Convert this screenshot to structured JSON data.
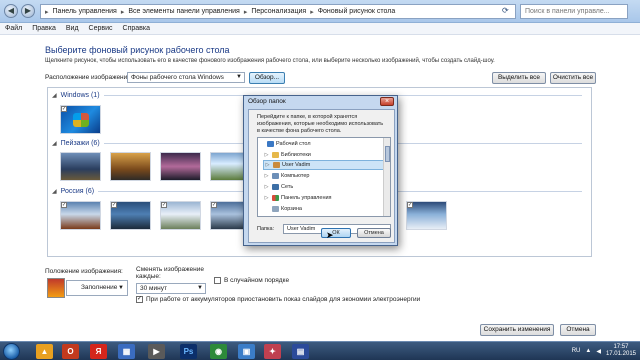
{
  "address_bar": {
    "crumbs": [
      "Панель управления",
      "Все элементы панели управления",
      "Персонализация",
      "Фоновый рисунок стола"
    ],
    "search_placeholder": "Поиск в панели управле..."
  },
  "menu": [
    "Файл",
    "Правка",
    "Вид",
    "Сервис",
    "Справка"
  ],
  "heading": "Выберите фоновый рисунок рабочего стола",
  "subtext": "Щелкните рисунок, чтобы использовать его в качестве фонового изображения рабочего стола, или выберите несколько изображений, чтобы создать слайд-шоу.",
  "location": {
    "label": "Расположение изображения:",
    "value": "Фоны рабочего стола Windows",
    "browse_label": "Обзор...",
    "select_all_label": "Выделить все",
    "clear_all_label": "Очистить все"
  },
  "groups": [
    {
      "title": "Windows (1)"
    },
    {
      "title": "Пейзажи (6)"
    },
    {
      "title": "Россия (6)"
    }
  ],
  "position": {
    "label": "Положение изображения:",
    "value": "Заполнение"
  },
  "slideshow": {
    "change_label": "Сменять изображение каждые:",
    "interval_value": "30 минут",
    "shuffle_label": "В случайном порядке",
    "battery_label": "При работе от аккумуляторов приостановить показ слайдов для экономии электроэнергии"
  },
  "footer": {
    "save_label": "Сохранить изменения",
    "cancel_label": "Отмена"
  },
  "dialog": {
    "title": "Обзор папок",
    "description": "Перейдите к папке, в которой хранятся изображения, которые необходимо использовать в качестве фона рабочего стола.",
    "tree": [
      "Рабочий стол",
      "Библиотеки",
      "User Vadim",
      "Компьютер",
      "Сеть",
      "Панель управления",
      "Корзина"
    ],
    "folder_label": "Папка:",
    "folder_value": "User Vadim",
    "ok_label": "ОК",
    "cancel_label": "Отмена"
  },
  "taskbar": {
    "lang": "RU",
    "time": "17:57",
    "date": "17.01.2015"
  }
}
